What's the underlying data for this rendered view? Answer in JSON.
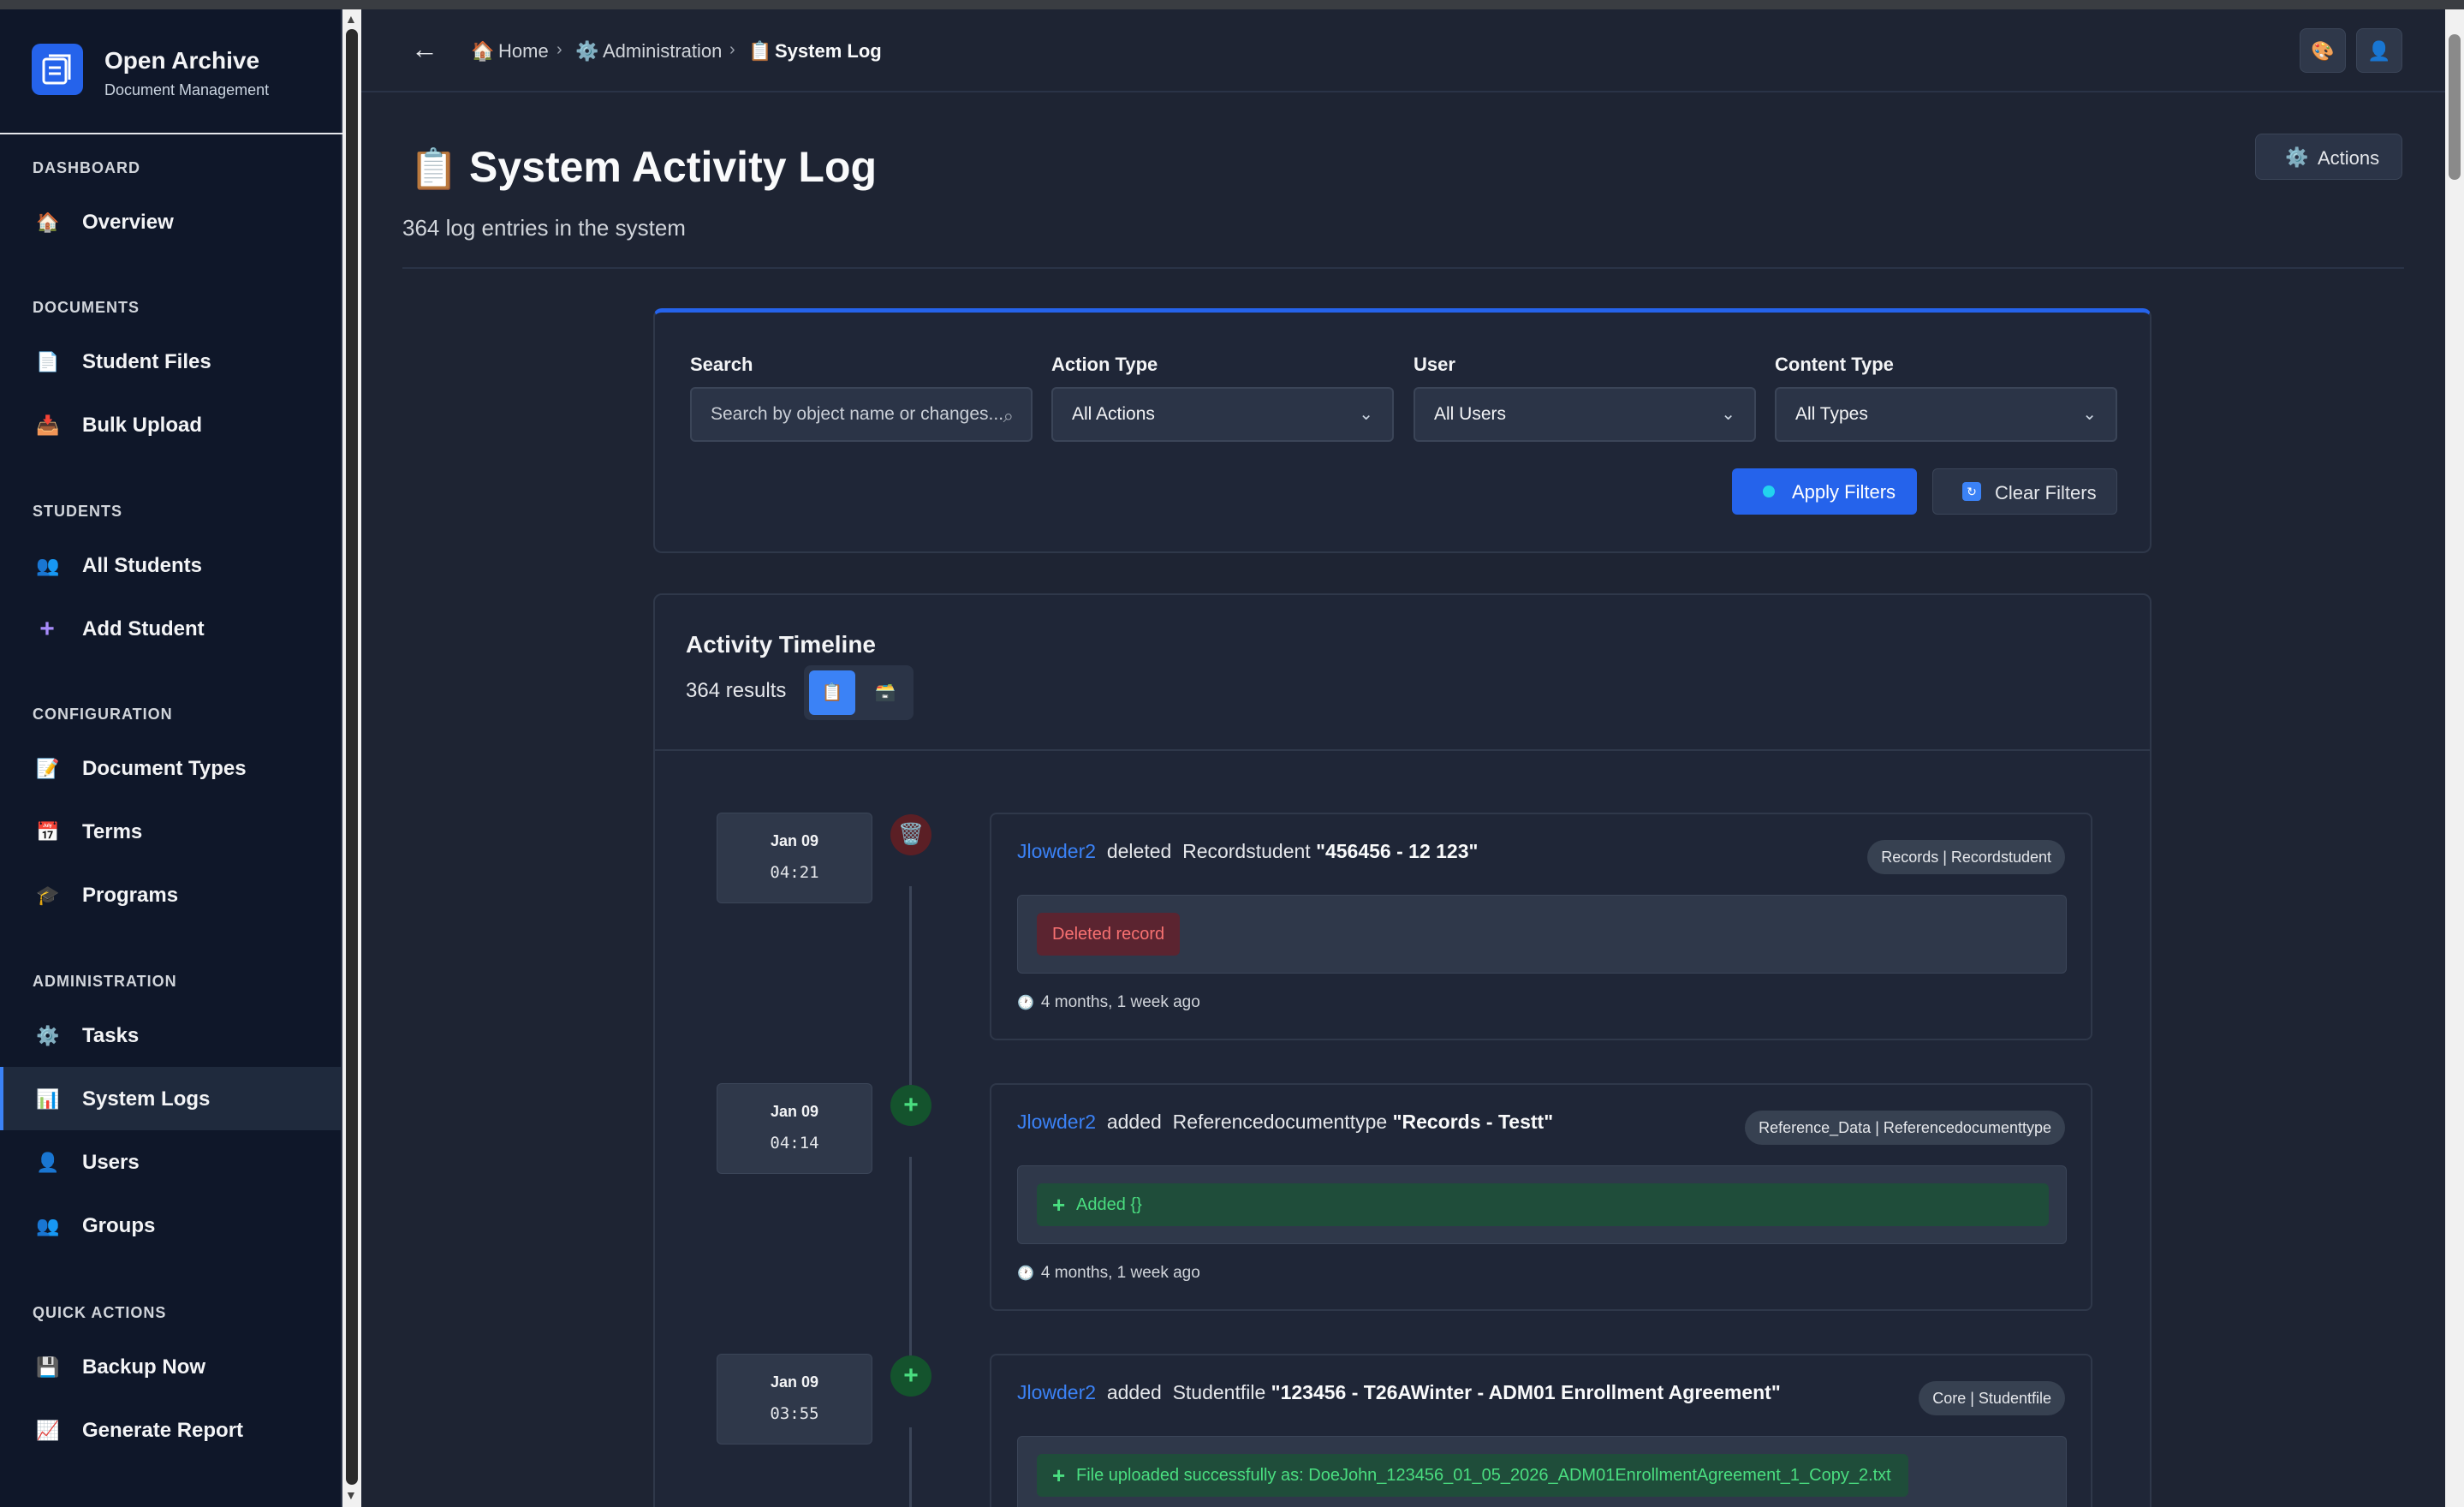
{
  "brand": {
    "title": "Open Archive",
    "subtitle": "Document Management"
  },
  "sidebar": {
    "sections": {
      "dashboard": "DASHBOARD",
      "documents": "DOCUMENTS",
      "students": "STUDENTS",
      "configuration": "CONFIGURATION",
      "administration": "ADMINISTRATION",
      "quick_actions": "QUICK ACTIONS"
    },
    "items": {
      "overview": "Overview",
      "student_files": "Student Files",
      "bulk_upload": "Bulk Upload",
      "all_students": "All Students",
      "add_student": "Add Student",
      "document_types": "Document Types",
      "terms": "Terms",
      "programs": "Programs",
      "tasks": "Tasks",
      "system_logs": "System Logs",
      "users": "Users",
      "groups": "Groups",
      "backup_now": "Backup Now",
      "generate_report": "Generate Report"
    },
    "active": "system_logs"
  },
  "breadcrumb": {
    "home": "Home",
    "administration": "Administration",
    "current": "System Log"
  },
  "page": {
    "title": "System Activity Log",
    "subtitle": "364 log entries in the system",
    "actions_label": "Actions"
  },
  "filters": {
    "search_label": "Search",
    "search_placeholder": "Search by object name or changes...",
    "action_label": "Action Type",
    "action_value": "All Actions",
    "user_label": "User",
    "user_value": "All Users",
    "content_label": "Content Type",
    "content_value": "All Types",
    "apply_label": "Apply Filters",
    "clear_label": "Clear Filters"
  },
  "timeline": {
    "title": "Activity Timeline",
    "count": "364 results",
    "entries": [
      {
        "date": "Jan 09",
        "time": "04:21",
        "user": "Jlowder2",
        "action": "deleted",
        "model": "Recordstudent",
        "object": "\"456456 - 12 123\"",
        "tag": "Records | Recordstudent",
        "change": "Deleted record",
        "ago": "4 months, 1 week ago"
      },
      {
        "date": "Jan 09",
        "time": "04:14",
        "user": "Jlowder2",
        "action": "added",
        "model": "Referencedocumenttype",
        "object": "\"Records - Testt\"",
        "tag": "Reference_Data | Referencedocumenttype",
        "change": "Added {}",
        "ago": "4 months, 1 week ago"
      },
      {
        "date": "Jan 09",
        "time": "03:55",
        "user": "Jlowder2",
        "action": "added",
        "model": "Studentfile",
        "object": "\"123456 - T26AWinter - ADM01 Enrollment Agreement\"",
        "tag": "Core | Studentfile",
        "change": "File uploaded successfully as: DoeJohn_123456_01_05_2026_ADM01EnrollmentAgreement_1_Copy_2.txt",
        "ago": ""
      }
    ]
  },
  "colors": {
    "accent": "#2563eb",
    "link": "#3b82f6",
    "danger": "#f87171",
    "success": "#4ade80",
    "background": "#1e2433",
    "sidebar": "#0f1729"
  }
}
